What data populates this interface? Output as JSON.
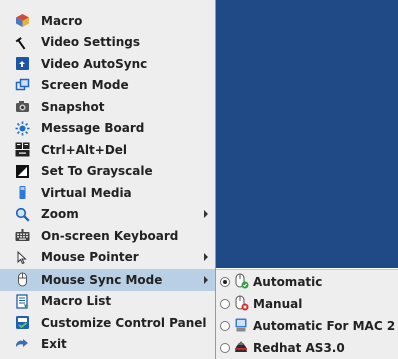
{
  "colors": {
    "desktop_blue": "#1f4a85",
    "menu_bg": "#eeeeee",
    "selection": "#b8cfe5"
  },
  "menu": {
    "items": [
      {
        "label": "Macro",
        "icon": "macro-icon",
        "submenu": false
      },
      {
        "label": "Video Settings",
        "icon": "wrench-icon",
        "submenu": false
      },
      {
        "label": "Video AutoSync",
        "icon": "autosync-icon",
        "submenu": false
      },
      {
        "label": "Screen Mode",
        "icon": "screen-mode-icon",
        "submenu": false
      },
      {
        "label": "Snapshot",
        "icon": "camera-icon",
        "submenu": false
      },
      {
        "label": "Message Board",
        "icon": "message-board-icon",
        "submenu": false
      },
      {
        "label": "Ctrl+Alt+Del",
        "icon": "ctrl-alt-del-icon",
        "submenu": false
      },
      {
        "label": "Set To Grayscale",
        "icon": "grayscale-icon",
        "submenu": false
      },
      {
        "label": "Virtual Media",
        "icon": "virtual-media-icon",
        "submenu": false
      },
      {
        "label": "Zoom",
        "icon": "zoom-icon",
        "submenu": true
      },
      {
        "label": "On-screen Keyboard",
        "icon": "keyboard-icon",
        "submenu": false
      },
      {
        "label": "Mouse Pointer",
        "icon": "mouse-pointer-icon",
        "submenu": true
      },
      {
        "label": "Mouse Sync Mode",
        "icon": "mouse-icon",
        "submenu": true,
        "selected": true
      },
      {
        "label": "Macro List",
        "icon": "macro-list-icon",
        "submenu": false
      },
      {
        "label": "Customize Control Panel",
        "icon": "customize-panel-icon",
        "submenu": false
      },
      {
        "label": "Exit",
        "icon": "exit-icon",
        "submenu": false
      }
    ]
  },
  "submenu": {
    "items": [
      {
        "label": "Automatic",
        "icon": "auto-mouse-icon",
        "checked": true
      },
      {
        "label": "Manual",
        "icon": "manual-mouse-icon",
        "checked": false
      },
      {
        "label": "Automatic For MAC 2",
        "icon": "mac-icon",
        "checked": false
      },
      {
        "label": "Redhat AS3.0",
        "icon": "redhat-icon",
        "checked": false
      }
    ]
  }
}
